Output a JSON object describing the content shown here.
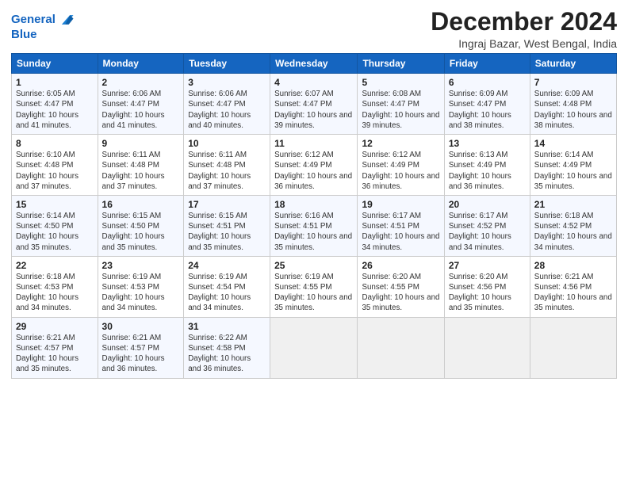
{
  "header": {
    "logo_line1": "General",
    "logo_line2": "Blue",
    "title": "December 2024",
    "subtitle": "Ingraj Bazar, West Bengal, India"
  },
  "weekdays": [
    "Sunday",
    "Monday",
    "Tuesday",
    "Wednesday",
    "Thursday",
    "Friday",
    "Saturday"
  ],
  "weeks": [
    [
      {
        "day": "1",
        "sunrise": "Sunrise: 6:05 AM",
        "sunset": "Sunset: 4:47 PM",
        "daylight": "Daylight: 10 hours and 41 minutes."
      },
      {
        "day": "2",
        "sunrise": "Sunrise: 6:06 AM",
        "sunset": "Sunset: 4:47 PM",
        "daylight": "Daylight: 10 hours and 41 minutes."
      },
      {
        "day": "3",
        "sunrise": "Sunrise: 6:06 AM",
        "sunset": "Sunset: 4:47 PM",
        "daylight": "Daylight: 10 hours and 40 minutes."
      },
      {
        "day": "4",
        "sunrise": "Sunrise: 6:07 AM",
        "sunset": "Sunset: 4:47 PM",
        "daylight": "Daylight: 10 hours and 39 minutes."
      },
      {
        "day": "5",
        "sunrise": "Sunrise: 6:08 AM",
        "sunset": "Sunset: 4:47 PM",
        "daylight": "Daylight: 10 hours and 39 minutes."
      },
      {
        "day": "6",
        "sunrise": "Sunrise: 6:09 AM",
        "sunset": "Sunset: 4:47 PM",
        "daylight": "Daylight: 10 hours and 38 minutes."
      },
      {
        "day": "7",
        "sunrise": "Sunrise: 6:09 AM",
        "sunset": "Sunset: 4:48 PM",
        "daylight": "Daylight: 10 hours and 38 minutes."
      }
    ],
    [
      {
        "day": "8",
        "sunrise": "Sunrise: 6:10 AM",
        "sunset": "Sunset: 4:48 PM",
        "daylight": "Daylight: 10 hours and 37 minutes."
      },
      {
        "day": "9",
        "sunrise": "Sunrise: 6:11 AM",
        "sunset": "Sunset: 4:48 PM",
        "daylight": "Daylight: 10 hours and 37 minutes."
      },
      {
        "day": "10",
        "sunrise": "Sunrise: 6:11 AM",
        "sunset": "Sunset: 4:48 PM",
        "daylight": "Daylight: 10 hours and 37 minutes."
      },
      {
        "day": "11",
        "sunrise": "Sunrise: 6:12 AM",
        "sunset": "Sunset: 4:49 PM",
        "daylight": "Daylight: 10 hours and 36 minutes."
      },
      {
        "day": "12",
        "sunrise": "Sunrise: 6:12 AM",
        "sunset": "Sunset: 4:49 PM",
        "daylight": "Daylight: 10 hours and 36 minutes."
      },
      {
        "day": "13",
        "sunrise": "Sunrise: 6:13 AM",
        "sunset": "Sunset: 4:49 PM",
        "daylight": "Daylight: 10 hours and 36 minutes."
      },
      {
        "day": "14",
        "sunrise": "Sunrise: 6:14 AM",
        "sunset": "Sunset: 4:49 PM",
        "daylight": "Daylight: 10 hours and 35 minutes."
      }
    ],
    [
      {
        "day": "15",
        "sunrise": "Sunrise: 6:14 AM",
        "sunset": "Sunset: 4:50 PM",
        "daylight": "Daylight: 10 hours and 35 minutes."
      },
      {
        "day": "16",
        "sunrise": "Sunrise: 6:15 AM",
        "sunset": "Sunset: 4:50 PM",
        "daylight": "Daylight: 10 hours and 35 minutes."
      },
      {
        "day": "17",
        "sunrise": "Sunrise: 6:15 AM",
        "sunset": "Sunset: 4:51 PM",
        "daylight": "Daylight: 10 hours and 35 minutes."
      },
      {
        "day": "18",
        "sunrise": "Sunrise: 6:16 AM",
        "sunset": "Sunset: 4:51 PM",
        "daylight": "Daylight: 10 hours and 35 minutes."
      },
      {
        "day": "19",
        "sunrise": "Sunrise: 6:17 AM",
        "sunset": "Sunset: 4:51 PM",
        "daylight": "Daylight: 10 hours and 34 minutes."
      },
      {
        "day": "20",
        "sunrise": "Sunrise: 6:17 AM",
        "sunset": "Sunset: 4:52 PM",
        "daylight": "Daylight: 10 hours and 34 minutes."
      },
      {
        "day": "21",
        "sunrise": "Sunrise: 6:18 AM",
        "sunset": "Sunset: 4:52 PM",
        "daylight": "Daylight: 10 hours and 34 minutes."
      }
    ],
    [
      {
        "day": "22",
        "sunrise": "Sunrise: 6:18 AM",
        "sunset": "Sunset: 4:53 PM",
        "daylight": "Daylight: 10 hours and 34 minutes."
      },
      {
        "day": "23",
        "sunrise": "Sunrise: 6:19 AM",
        "sunset": "Sunset: 4:53 PM",
        "daylight": "Daylight: 10 hours and 34 minutes."
      },
      {
        "day": "24",
        "sunrise": "Sunrise: 6:19 AM",
        "sunset": "Sunset: 4:54 PM",
        "daylight": "Daylight: 10 hours and 34 minutes."
      },
      {
        "day": "25",
        "sunrise": "Sunrise: 6:19 AM",
        "sunset": "Sunset: 4:55 PM",
        "daylight": "Daylight: 10 hours and 35 minutes."
      },
      {
        "day": "26",
        "sunrise": "Sunrise: 6:20 AM",
        "sunset": "Sunset: 4:55 PM",
        "daylight": "Daylight: 10 hours and 35 minutes."
      },
      {
        "day": "27",
        "sunrise": "Sunrise: 6:20 AM",
        "sunset": "Sunset: 4:56 PM",
        "daylight": "Daylight: 10 hours and 35 minutes."
      },
      {
        "day": "28",
        "sunrise": "Sunrise: 6:21 AM",
        "sunset": "Sunset: 4:56 PM",
        "daylight": "Daylight: 10 hours and 35 minutes."
      }
    ],
    [
      {
        "day": "29",
        "sunrise": "Sunrise: 6:21 AM",
        "sunset": "Sunset: 4:57 PM",
        "daylight": "Daylight: 10 hours and 35 minutes."
      },
      {
        "day": "30",
        "sunrise": "Sunrise: 6:21 AM",
        "sunset": "Sunset: 4:57 PM",
        "daylight": "Daylight: 10 hours and 36 minutes."
      },
      {
        "day": "31",
        "sunrise": "Sunrise: 6:22 AM",
        "sunset": "Sunset: 4:58 PM",
        "daylight": "Daylight: 10 hours and 36 minutes."
      },
      null,
      null,
      null,
      null
    ]
  ]
}
